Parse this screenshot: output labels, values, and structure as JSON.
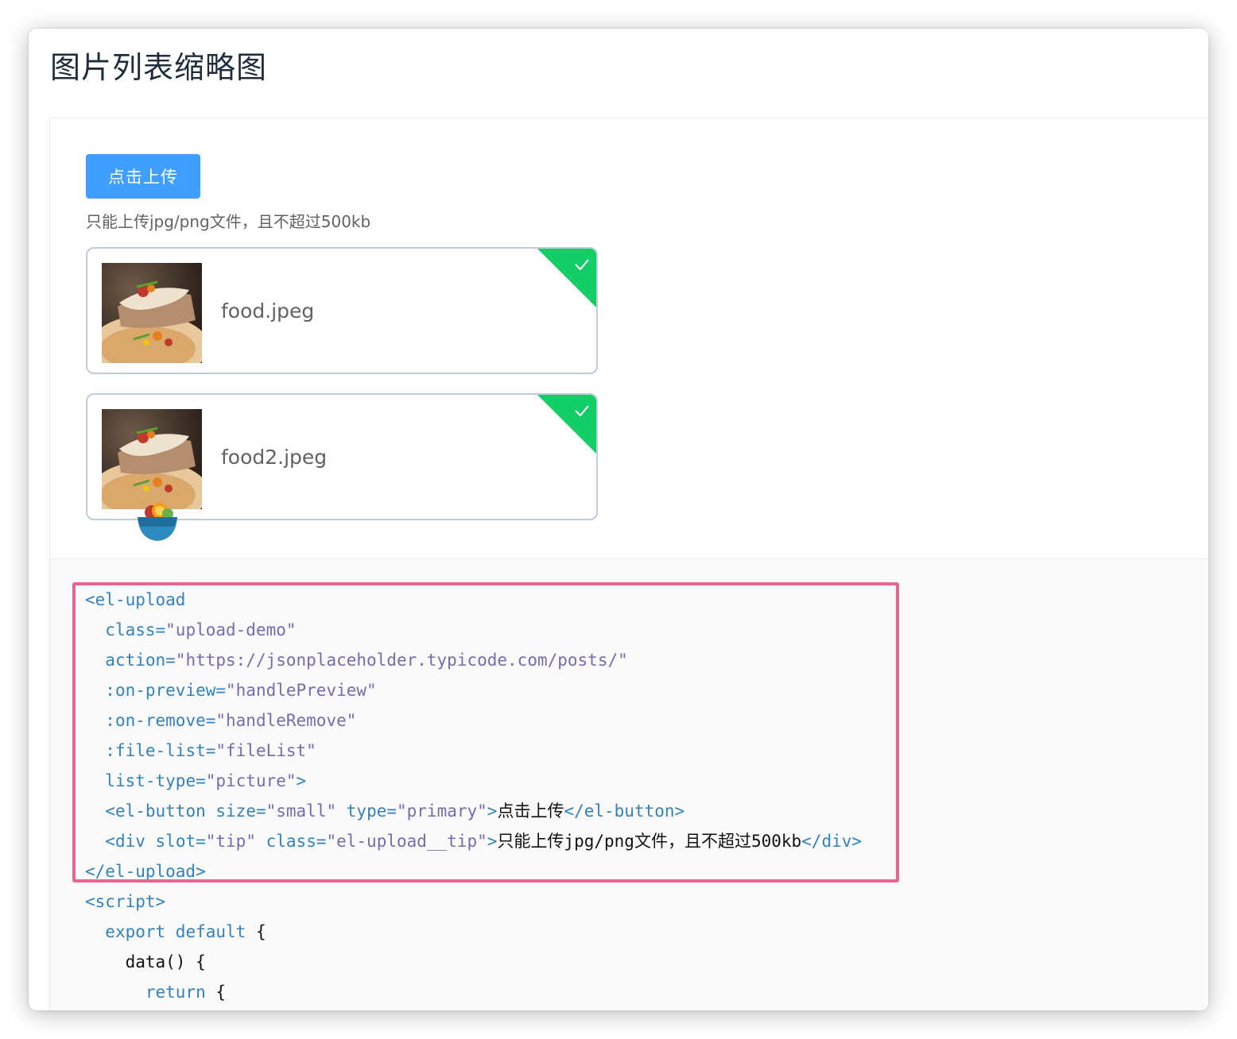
{
  "page": {
    "title": "图片列表缩略图"
  },
  "upload": {
    "button_label": "点击上传",
    "tip": "只能上传jpg/png文件，且不超过500kb",
    "files": [
      {
        "name": "food.jpeg",
        "status": "success"
      },
      {
        "name": "food2.jpeg",
        "status": "success"
      }
    ]
  },
  "colors": {
    "primary": "#409eff",
    "success": "#13ce66",
    "highlight_border": "#e8658f",
    "code_tag": "#3182bd",
    "code_string": "#756bb1"
  },
  "code": {
    "l1_tag": "<el-upload",
    "l2_attr": "class=",
    "l2_val": "\"upload-demo\"",
    "l3_attr": "action=",
    "l3_val": "\"https://jsonplaceholder.typicode.com/posts/\"",
    "l4_attr": ":on-preview=",
    "l4_val": "\"handlePreview\"",
    "l5_attr": ":on-remove=",
    "l5_val": "\"handleRemove\"",
    "l6_attr": ":file-list=",
    "l6_val": "\"fileList\"",
    "l7_attr": "list-type=",
    "l7_val": "\"picture\"",
    "l7_end": ">",
    "l8_open": "<el-button",
    "l8_attr1": "size=",
    "l8_val1": "\"small\"",
    "l8_attr2": "type=",
    "l8_val2": "\"primary\"",
    "l8_gt": ">",
    "l8_text": "点击上传",
    "l8_close": "</el-button>",
    "l9_open": "<div",
    "l9_attr1": "slot=",
    "l9_val1": "\"tip\"",
    "l9_attr2": "class=",
    "l9_val2": "\"el-upload__tip\"",
    "l9_gt": ">",
    "l9_text": "只能上传jpg/png文件，且不超过500kb",
    "l9_close": "</div>",
    "l10_tag": "</el-upload>",
    "l11_tag": "<script>",
    "l12_kw": "export default",
    "l12_brace": "{",
    "l13_fn": "data()",
    "l13_brace": "{",
    "l14_kw": "return",
    "l14_brace": "{"
  }
}
